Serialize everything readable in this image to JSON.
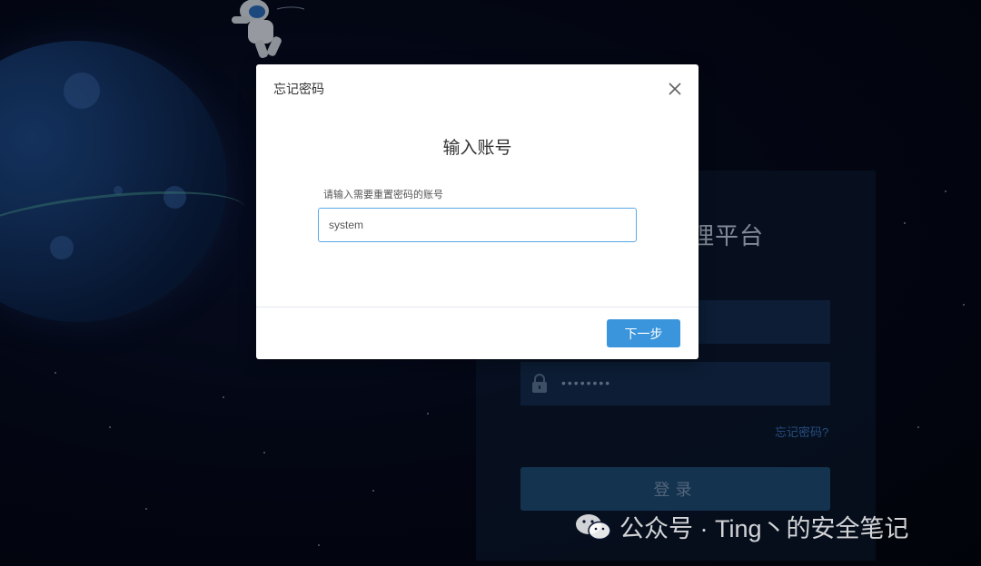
{
  "modal": {
    "title": "忘记密码",
    "heading": "输入账号",
    "field_label": "请输入需要重置密码的账号",
    "account_value": "system",
    "next_label": "下一步"
  },
  "login": {
    "title_partial": "理平台",
    "password_mask": "••••••••",
    "forgot_label": "忘记密码?",
    "login_label": "登录"
  },
  "watermark": {
    "text": "公众号 · Ting丶的安全笔记"
  },
  "colors": {
    "primary": "#3a95dc",
    "input_border": "#5aa9e6",
    "background": "#04081a"
  }
}
